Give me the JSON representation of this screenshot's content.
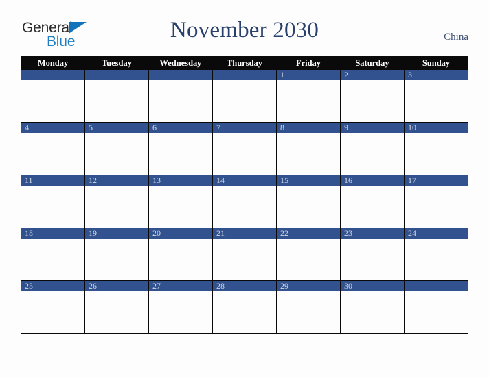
{
  "logo": {
    "word_one": "General",
    "word_two": "Blue",
    "triangle_icon": "blue-triangle-icon",
    "accent_dark": "#2b2b2b",
    "accent_blue": "#1f7fc4"
  },
  "header": {
    "title": "November 2030",
    "country": "China",
    "title_color": "#28406b"
  },
  "calendar": {
    "weekday_headers": [
      "Monday",
      "Tuesday",
      "Wednesday",
      "Thursday",
      "Friday",
      "Saturday",
      "Sunday"
    ],
    "header_bg": "#0a0a0a",
    "header_text_color": "#ffffff",
    "daybar_bg": "#31528f",
    "daynum_color": "#d3d8e2",
    "cell_bg": "#fdfdfd",
    "border_color": "#0a0a0a",
    "weeks": [
      [
        "",
        "",
        "",
        "",
        "1",
        "2",
        "3"
      ],
      [
        "4",
        "5",
        "6",
        "7",
        "8",
        "9",
        "10"
      ],
      [
        "11",
        "12",
        "13",
        "14",
        "15",
        "16",
        "17"
      ],
      [
        "18",
        "19",
        "20",
        "21",
        "22",
        "23",
        "24"
      ],
      [
        "25",
        "26",
        "27",
        "28",
        "29",
        "30",
        ""
      ]
    ]
  }
}
